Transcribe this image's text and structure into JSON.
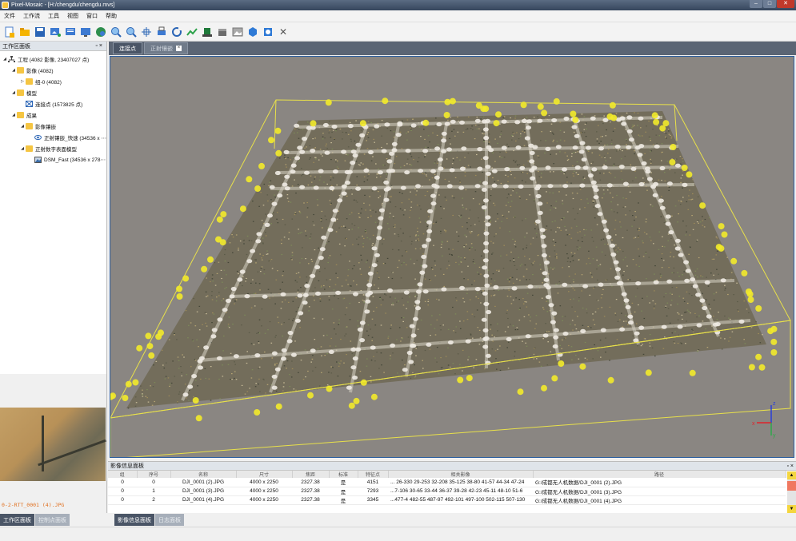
{
  "window": {
    "title": "Pixel-Mosaic - [H:/chengdu/chengdu.mvs]",
    "minimize": "–",
    "maximize": "□",
    "close": "✕"
  },
  "menu": [
    "文件",
    "工作流",
    "工具",
    "视图",
    "窗口",
    "帮助"
  ],
  "toolbar": {
    "icons": [
      "new-project-icon",
      "open-folder-icon",
      "save-icon",
      "import-image-icon",
      "export-icon",
      "report-icon",
      "globe-icon",
      "zoom-in-icon",
      "zoom-out-icon",
      "fit-view-icon",
      "print-icon",
      "refresh-icon",
      "chart-icon",
      "pin-green-icon",
      "cube-icon",
      "image-icon",
      "hexagon-icon",
      "square-icon",
      "close-x-icon"
    ]
  },
  "left_panel": {
    "title": "工作区面板",
    "float_btn": "▫",
    "close_btn": "×",
    "tree": [
      {
        "depth": 0,
        "expanded": true,
        "icon": "project",
        "label": "工程 (4082 影像, 23407027 点)"
      },
      {
        "depth": 1,
        "expanded": true,
        "icon": "folder",
        "label": "影像 (4082)"
      },
      {
        "depth": 2,
        "expanded": false,
        "icon": "folder",
        "label": "组-0 (4082)"
      },
      {
        "depth": 1,
        "expanded": true,
        "icon": "folder",
        "label": "模型"
      },
      {
        "depth": 2,
        "expanded": null,
        "icon": "points",
        "label": "连接点 (1573825 点)"
      },
      {
        "depth": 1,
        "expanded": true,
        "icon": "folder",
        "label": "成果"
      },
      {
        "depth": 2,
        "expanded": true,
        "icon": "folder",
        "label": "影像镶嵌"
      },
      {
        "depth": 3,
        "expanded": null,
        "icon": "eye",
        "label": "正射镶嵌_快速 (34536 x ⋯"
      },
      {
        "depth": 2,
        "expanded": true,
        "icon": "folder",
        "label": "正射数字表面模型"
      },
      {
        "depth": 3,
        "expanded": null,
        "icon": "image",
        "label": "DSM_Fast (34536 x 278⋯"
      }
    ]
  },
  "thumbnail": {
    "caption": "0-2-RTT_0001 (4).JPG"
  },
  "doc_tabs": [
    {
      "label": "连接点",
      "active": true
    },
    {
      "label": "正射镶嵌",
      "active": false,
      "close": "×"
    }
  ],
  "bottom_panel": {
    "title": "影像信息面板",
    "float_btn": "▫",
    "close_btn": "×",
    "columns": [
      "组",
      "序号",
      "名称",
      "尺寸",
      "焦距",
      "标准",
      "特征点",
      "相关影像",
      "路径"
    ],
    "rows": [
      [
        "0",
        "0",
        "DJI_0001 (2).JPG",
        "4000 x 2250",
        "2327.38",
        "是",
        "4151",
        "... 26-330 29-253 32-208 35-125 38-80 41-57 44-34 47-24",
        "G:/成都无人机数据/DJI_0001 (2).JPG"
      ],
      [
        "0",
        "1",
        "DJI_0001 (3).JPG",
        "4000 x 2250",
        "2327.38",
        "是",
        "7293",
        "...7-106 30-65 33-44 36-37 39-28 42-23 45-11 48-10 51-6",
        "G:/成都无人机数据/DJI_0001 (3).JPG"
      ],
      [
        "0",
        "2",
        "DJI_0001 (4).JPG",
        "4000 x 2250",
        "2327.38",
        "是",
        "3345",
        "...477-4 482-55 487-97 492-101 497-100 502-115 507-130",
        "G:/成都无人机数据/DJI_0001 (4).JPG"
      ]
    ]
  },
  "bottom_tabs_left": [
    {
      "label": "工作区面板",
      "active": true
    },
    {
      "label": "控制点面板",
      "active": false
    }
  ],
  "bottom_tabs_right": [
    {
      "label": "影像信息面板",
      "active": true
    },
    {
      "label": "日志面板",
      "active": false
    }
  ],
  "axis_gizmo": {
    "x": "x",
    "y": "y",
    "z": "z"
  },
  "colors": {
    "viewport_bg": "#8a8682",
    "bounding_box": "#e8e04a",
    "camera_point": "#f2ea2a",
    "title_bar": "#3f4f66",
    "accent_tab": "#4a5566"
  }
}
